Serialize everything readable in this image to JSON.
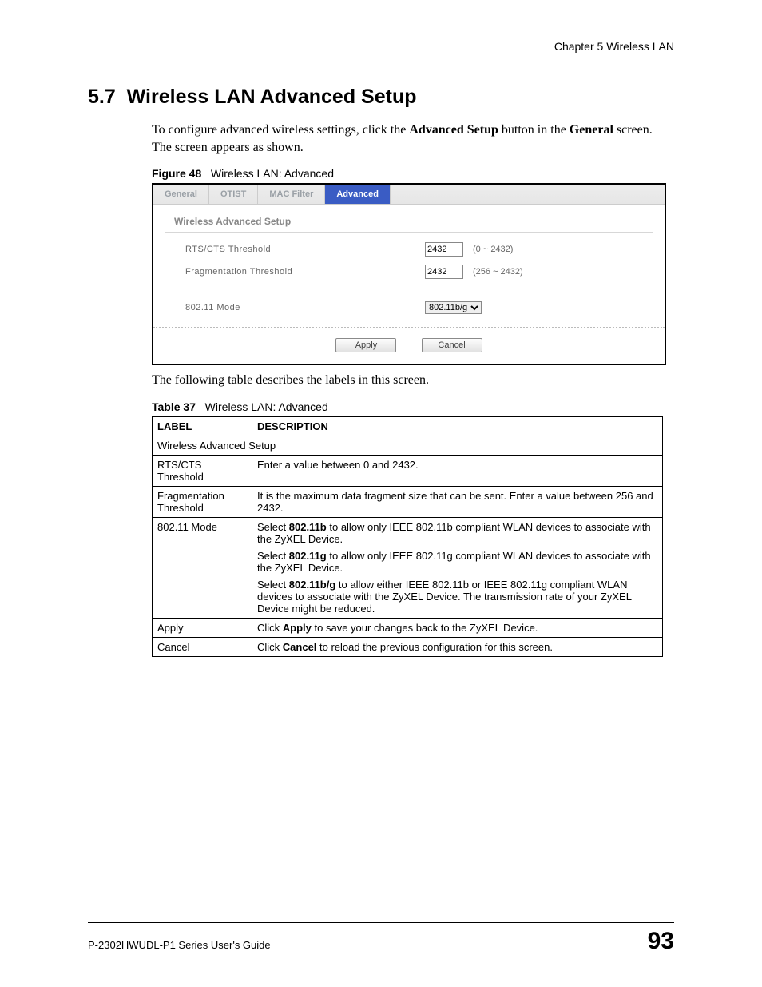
{
  "header": {
    "chapter": "Chapter 5 Wireless LAN"
  },
  "section": {
    "number": "5.7",
    "title": "Wireless LAN Advanced Setup",
    "intro_prefix": "To configure advanced wireless settings, click the ",
    "intro_bold1": "Advanced Setup",
    "intro_mid": " button in the ",
    "intro_bold2": "General",
    "intro_suffix": " screen. The screen appears as shown."
  },
  "figure": {
    "label": "Figure 48",
    "caption": "Wireless LAN: Advanced"
  },
  "shot": {
    "tabs": {
      "t0": "General",
      "t1": "OTIST",
      "t2": "MAC Filter",
      "t3": "Advanced"
    },
    "panel_title": "Wireless Advanced Setup",
    "rts_label": "RTS/CTS Threshold",
    "rts_value": "2432",
    "rts_range": "(0 ~ 2432)",
    "frag_label": "Fragmentation Threshold",
    "frag_value": "2432",
    "frag_range": "(256 ~ 2432)",
    "mode_label": "802.11 Mode",
    "mode_value": "802.11b/g",
    "apply": "Apply",
    "cancel": "Cancel"
  },
  "after_figure": "The following table describes the labels in this screen.",
  "table_caption": {
    "label": "Table 37",
    "caption": "Wireless LAN: Advanced"
  },
  "table": {
    "hdr_label": "LABEL",
    "hdr_desc": "DESCRIPTION",
    "span_row": "Wireless Advanced Setup",
    "rows": {
      "r1": {
        "label": "RTS/CTS Threshold",
        "desc": "Enter a value between 0 and 2432."
      },
      "r2": {
        "label": "Fragmentation Threshold",
        "desc": "It is the maximum data fragment size that can be sent. Enter a value between 256 and 2432."
      },
      "r3": {
        "label": "802.11 Mode",
        "p1a": "Select ",
        "p1b": "802.11b",
        "p1c": " to allow only IEEE 802.11b compliant WLAN devices to associate with the ZyXEL Device.",
        "p2a": "Select ",
        "p2b": "802.11g",
        "p2c": " to allow only IEEE 802.11g compliant WLAN devices to associate with the ZyXEL Device.",
        "p3a": "Select ",
        "p3b": "802.11b/g",
        "p3c": " to allow either IEEE 802.11b or IEEE 802.11g compliant WLAN devices to associate with the ZyXEL Device. The transmission rate of your ZyXEL Device might be reduced."
      },
      "r4": {
        "label": "Apply",
        "desc_a": "Click ",
        "desc_b": "Apply",
        "desc_c": " to save your changes back to the ZyXEL Device."
      },
      "r5": {
        "label": "Cancel",
        "desc_a": "Click ",
        "desc_b": "Cancel",
        "desc_c": " to reload the previous configuration for this screen."
      }
    }
  },
  "footer": {
    "guide": "P-2302HWUDL-P1 Series User's Guide",
    "page": "93"
  }
}
